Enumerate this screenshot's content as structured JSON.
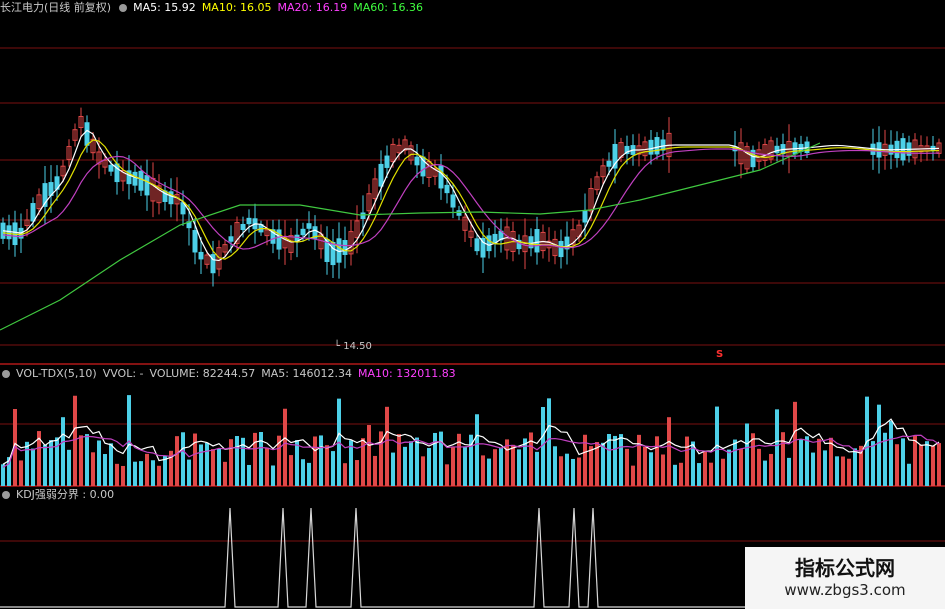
{
  "price_panel": {
    "title": "长江电力(日线 前复权)",
    "ma": [
      {
        "label": "MA5: 15.92",
        "color": "#ffffff"
      },
      {
        "label": "MA10: 16.05",
        "color": "#ffff00"
      },
      {
        "label": "MA20: 16.19",
        "color": "#ff40ff"
      },
      {
        "label": "MA60: 16.36",
        "color": "#40ff40"
      }
    ],
    "low_marker": "14.50",
    "marker_s": "S"
  },
  "volume_panel": {
    "title": "VOL-TDX(5,10)",
    "vvol": "VVOL: -",
    "volume": "VOLUME: 82244.57",
    "ma5": "MA5: 146012.34",
    "ma10": "MA10: 132011.83",
    "ma10_color": "#ff40ff"
  },
  "kdj_panel": {
    "title": "KDJ强弱分界 : 0.00"
  },
  "watermark": {
    "line1": "指标公式网",
    "line2": "www.zbgs3.com"
  },
  "colors": {
    "up": "#e04848",
    "down": "#4dd0e8",
    "grid": "#7a1010",
    "ma60": "#40c840",
    "ma20": "#c040c0",
    "ma10": "#e0e000",
    "ma5": "#ffffff"
  }
}
